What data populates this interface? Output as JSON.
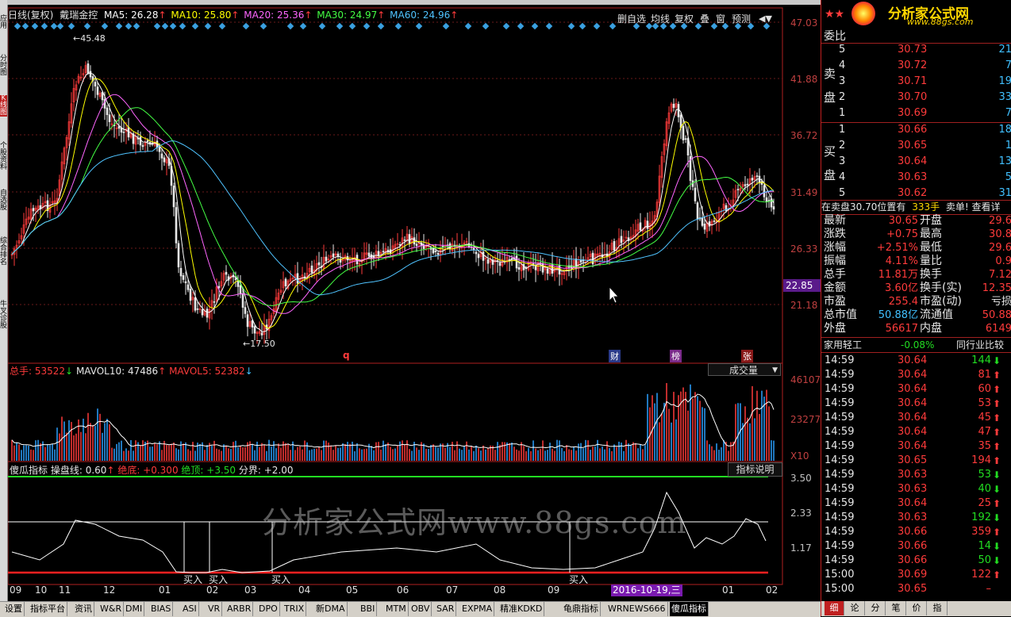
{
  "chart_header": {
    "period": "日线(复权)",
    "stock_name": "戴瑞金控",
    "ma5": "MA5: 26.28",
    "ma10": "MA10: 25.80",
    "ma20": "MA20: 25.36",
    "ma30": "MA30: 24.97",
    "ma60": "MA60: 24.96"
  },
  "toolbar": {
    "del_watch": "删自选",
    "ma_line": "均线",
    "restore": "复权",
    "overlay": "叠",
    "window": "窗",
    "forecast": "预测"
  },
  "price_scale": [
    "47.03",
    "41.88",
    "36.72",
    "31.49",
    "26.33",
    "21.18"
  ],
  "price_current": "22.85",
  "price_annotations": {
    "high": "45.48",
    "low": "17.50"
  },
  "chart_markers": {
    "q": "q",
    "cai": "财",
    "bang": "榜",
    "zhang": "张"
  },
  "volume_header": {
    "total": "总手: 53522",
    "mavol10": "MAVOL10: 47486",
    "mavol5": "MAVOL5: 52382",
    "dropdown": "成交量"
  },
  "volume_scale": [
    "46107",
    "23277",
    "X10"
  ],
  "indicator_header": {
    "name": "傻瓜指标",
    "line": "操盘线: 0.60",
    "bottom": "绝底: +0.300",
    "top": "绝顶: +3.50",
    "divide": "分界: +2.00",
    "help": "指标说明"
  },
  "indicator_scale": [
    "3.50",
    "2.33",
    "1.17"
  ],
  "buy_labels": [
    "买入",
    "买入",
    "买入",
    "买入"
  ],
  "watermark": "分析家公式网www.88gs.com",
  "x_axis": [
    "09",
    "10",
    "11",
    "12",
    "01",
    "02",
    "03",
    "04",
    "05",
    "06",
    "07",
    "08",
    "09",
    "10",
    "12",
    "01",
    "02"
  ],
  "x_cursor_date": "2016-10-19,三",
  "bottom_tabs": [
    "设置",
    "指标平台",
    "资讯",
    "W&R",
    "DMI",
    "BIAS",
    "ASI",
    "VR",
    "ARBR",
    "DPO",
    "TRIX",
    "新DMA",
    "BBI",
    "MTM",
    "OBV",
    "SAR",
    "EXPMA",
    "精准KDKD",
    "龟鼎指标",
    "WRNEWS666",
    "傻瓜指标"
  ],
  "left_tabs": [
    "应用",
    "分时图",
    "K线图",
    "个股资料",
    "自选股",
    "综合排名",
    "牛叉诊股"
  ],
  "logo": {
    "title": "分析家公式网",
    "url": "www.88gs.com"
  },
  "order_book": {
    "header": "委比",
    "sell_label": "卖盘",
    "buy_label": "买盘",
    "sells": [
      {
        "lvl": "5",
        "price": "30.73",
        "vol": "21"
      },
      {
        "lvl": "4",
        "price": "30.72",
        "vol": "7"
      },
      {
        "lvl": "3",
        "price": "30.71",
        "vol": "19"
      },
      {
        "lvl": "2",
        "price": "30.70",
        "vol": "33"
      },
      {
        "lvl": "1",
        "price": "30.69",
        "vol": "7"
      }
    ],
    "buys": [
      {
        "lvl": "1",
        "price": "30.66",
        "vol": "18"
      },
      {
        "lvl": "2",
        "price": "30.65",
        "vol": "1"
      },
      {
        "lvl": "3",
        "price": "30.64",
        "vol": "13"
      },
      {
        "lvl": "4",
        "price": "30.63",
        "vol": "5"
      },
      {
        "lvl": "5",
        "price": "30.62",
        "vol": "31"
      }
    ],
    "notice_a": "在卖盘30.70位置有",
    "notice_b": "333手",
    "notice_c": "卖单! 查看详"
  },
  "quote": [
    {
      "l1": "最新",
      "v1": "30.65",
      "l2": "开盘",
      "v2": "29.6"
    },
    {
      "l1": "涨跌",
      "v1": "+0.75",
      "l2": "最高",
      "v2": "30.8"
    },
    {
      "l1": "涨幅",
      "v1": "+2.51%",
      "l2": "最低",
      "v2": "29.6"
    },
    {
      "l1": "振幅",
      "v1": "4.11%",
      "l2": "量比",
      "v2": "0.9"
    },
    {
      "l1": "总手",
      "v1": "11.81万",
      "l2": "换手",
      "v2": "7.12"
    },
    {
      "l1": "金额",
      "v1": "3.60亿",
      "l2": "换手(实)",
      "v2": "12.35"
    },
    {
      "l1": "市盈",
      "v1": "255.4",
      "l2": "市盈(动)",
      "v2": "亏损"
    },
    {
      "l1": "总市值",
      "v1": "50.88亿",
      "l2": "流通值",
      "v2": "50.88"
    },
    {
      "l1": "外盘",
      "v1": "56617",
      "l2": "内盘",
      "v2": "6149"
    }
  ],
  "industry": {
    "name": "家用轻工",
    "change": "-0.08%",
    "compare": "同行业比较"
  },
  "ticks": [
    {
      "t": "14:59",
      "p": "30.64",
      "v": "144",
      "d": "down"
    },
    {
      "t": "14:59",
      "p": "30.64",
      "v": "81",
      "d": "up"
    },
    {
      "t": "14:59",
      "p": "30.64",
      "v": "60",
      "d": "up"
    },
    {
      "t": "14:59",
      "p": "30.64",
      "v": "53",
      "d": "up"
    },
    {
      "t": "14:59",
      "p": "30.64",
      "v": "45",
      "d": "up"
    },
    {
      "t": "14:59",
      "p": "30.64",
      "v": "47",
      "d": "up"
    },
    {
      "t": "14:59",
      "p": "30.64",
      "v": "35",
      "d": "up"
    },
    {
      "t": "14:59",
      "p": "30.65",
      "v": "194",
      "d": "up"
    },
    {
      "t": "14:59",
      "p": "30.63",
      "v": "53",
      "d": "down"
    },
    {
      "t": "14:59",
      "p": "30.63",
      "v": "40",
      "d": "down"
    },
    {
      "t": "14:59",
      "p": "30.64",
      "v": "25",
      "d": "up"
    },
    {
      "t": "14:59",
      "p": "30.63",
      "v": "192",
      "d": "down"
    },
    {
      "t": "14:59",
      "p": "30.66",
      "v": "359",
      "d": "up"
    },
    {
      "t": "14:59",
      "p": "30.66",
      "v": "14",
      "d": "down"
    },
    {
      "t": "14:59",
      "p": "30.66",
      "v": "50",
      "d": "down"
    },
    {
      "t": "15:00",
      "p": "30.69",
      "v": "122",
      "d": "up"
    },
    {
      "t": "15:00",
      "p": "30.65",
      "v": "–",
      "d": "none"
    }
  ],
  "right_tabs": [
    "细",
    "论",
    "分",
    "笔",
    "价",
    "指"
  ],
  "colors": {
    "up": "#ff3b3b",
    "down": "#22dd22",
    "ma5": "#ffffff",
    "ma10": "#ffff00",
    "ma20": "#ff66ff",
    "ma30": "#44ff44",
    "ma60": "#4fc3ff"
  }
}
